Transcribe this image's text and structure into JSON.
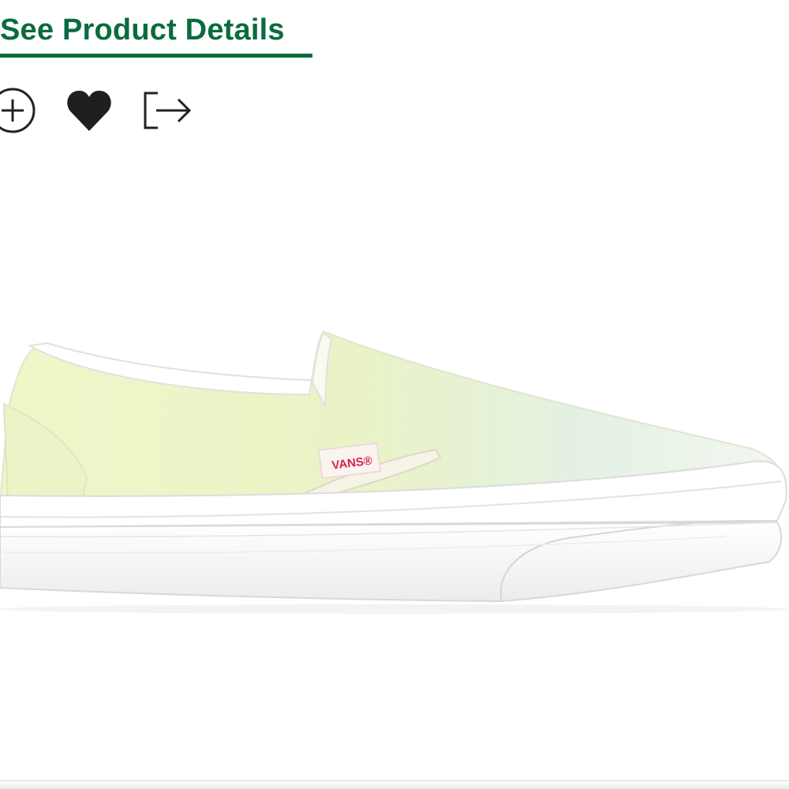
{
  "header": {
    "details_link_label": "See Product Details"
  },
  "actions": {
    "items": [
      {
        "name": "add-icon",
        "label": "Add"
      },
      {
        "name": "heart-icon",
        "label": "Favorite"
      },
      {
        "name": "share-icon",
        "label": "Share"
      }
    ]
  },
  "product": {
    "brand_label": "VANS®",
    "colors": {
      "upper": "#eef3c9",
      "sole": "#ffffff",
      "accent": "#0a6b3f",
      "brand_red": "#d2214e"
    }
  }
}
